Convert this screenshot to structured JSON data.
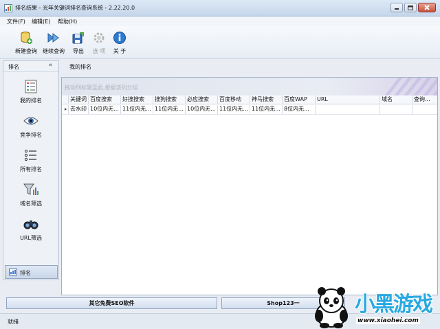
{
  "window": {
    "title": "排名结果 - 光年关键词排名查询系统 - 2.22.20.0"
  },
  "menu": [
    "文件(F)",
    "编辑(E)",
    "帮助(H)"
  ],
  "toolbar": [
    {
      "label": "新建查询",
      "icon": "new-query-icon",
      "enabled": true
    },
    {
      "label": "继续查询",
      "icon": "continue-query-icon",
      "enabled": true
    },
    {
      "label": "导出",
      "icon": "export-icon",
      "enabled": true
    },
    {
      "label": "选 项",
      "icon": "options-gear-icon",
      "enabled": false
    },
    {
      "label": "关 于",
      "icon": "about-info-icon",
      "enabled": true
    }
  ],
  "sidebar": {
    "header": "排名",
    "collapse_glyph": "«",
    "items": [
      {
        "label": "我的排名",
        "icon": "list-icon"
      },
      {
        "label": "竞争排名",
        "icon": "eye-icon"
      },
      {
        "label": "所有排名",
        "icon": "bullet-list-icon"
      },
      {
        "label": "域名筛选",
        "icon": "funnel-icon"
      },
      {
        "label": "URL筛选",
        "icon": "binoculars-icon"
      }
    ],
    "footer_item": "排名"
  },
  "main": {
    "tab": "我的排名",
    "group_hint": "拖动列标题至此,根据该列分组",
    "columns": [
      "关键词",
      "百度搜索",
      "好搜搜索",
      "搜狗搜索",
      "必应搜索",
      "百度移动",
      "神马搜索",
      "百度WAP",
      "URL",
      "域名",
      "查询..."
    ],
    "rows": [
      [
        "去水印",
        "10位内无...",
        "11位内无...",
        "11位内无...",
        "10位内无...",
        "11位内无...",
        "11位内无...",
        "8位内无...",
        "",
        "",
        ""
      ]
    ]
  },
  "buttons": {
    "free_seo": "其它免费SEO软件",
    "shop": "Shop123一"
  },
  "status": "就绪",
  "watermark": {
    "brand": "小黑游戏",
    "url": "www.xiaohei.com"
  }
}
